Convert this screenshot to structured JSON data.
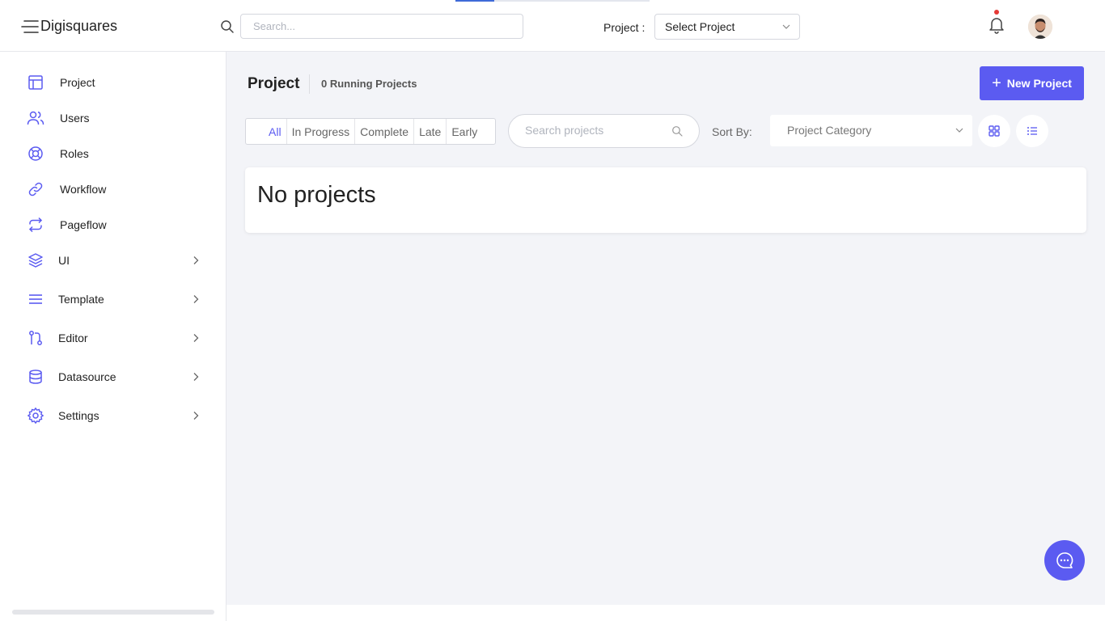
{
  "app": {
    "brand": "Digisquares"
  },
  "header": {
    "search_placeholder": "Search...",
    "project_label": "Project :",
    "project_select": "Select Project",
    "loading_progress_percent": 20
  },
  "sidebar": {
    "items": [
      {
        "label": "Project",
        "icon": "table-icon"
      },
      {
        "label": "Users",
        "icon": "users-icon"
      },
      {
        "label": "Roles",
        "icon": "lifebuoy-icon"
      },
      {
        "label": "Workflow",
        "icon": "link-icon"
      },
      {
        "label": "Pageflow",
        "icon": "repeat-icon"
      },
      {
        "label": "UI",
        "icon": "layers-icon",
        "expandable": true
      },
      {
        "label": "Template",
        "icon": "menu-icon",
        "expandable": true
      },
      {
        "label": "Editor",
        "icon": "git-pull-request-icon",
        "expandable": true
      },
      {
        "label": "Datasource",
        "icon": "database-icon",
        "expandable": true
      },
      {
        "label": "Settings",
        "icon": "gear-icon",
        "expandable": true
      }
    ]
  },
  "main": {
    "title": "Project",
    "running": "0 Running Projects",
    "new_button": "New Project",
    "filters": [
      "All",
      "In Progress",
      "Complete",
      "Late",
      "Early"
    ],
    "active_filter": "All",
    "search_placeholder": "Search projects",
    "sort_label": "Sort By:",
    "sort_value": "Project Category",
    "empty_message": "No projects"
  },
  "colors": {
    "accent": "#5b5bf1",
    "notification": "#e53935",
    "progress": "#3f6ad8"
  }
}
